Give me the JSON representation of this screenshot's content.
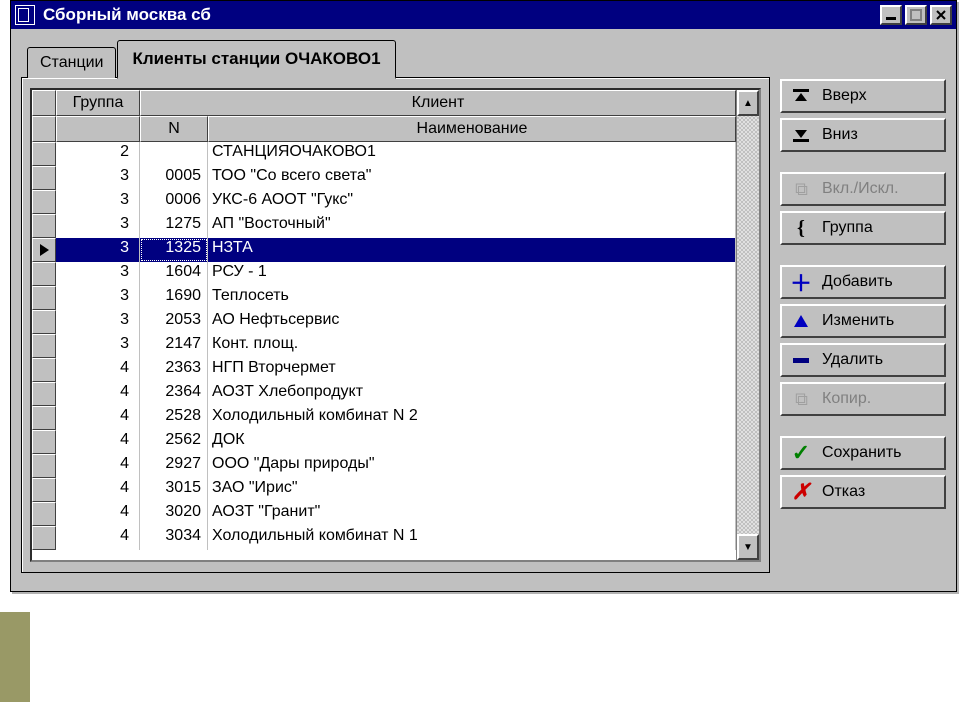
{
  "window": {
    "title": "Сборный москва сб"
  },
  "tabs": {
    "inactive": "Станции",
    "active": "Клиенты станции ОЧАКОВО1"
  },
  "columns": {
    "group": "Группа",
    "client": "Клиент",
    "n": "N",
    "name": "Наименование"
  },
  "rows": [
    {
      "group": "2",
      "n": "",
      "name": "СТАНЦИЯОЧАКОВО1"
    },
    {
      "group": "3",
      "n": "0005",
      "name": "ТОО \"Со всего света\""
    },
    {
      "group": "3",
      "n": "0006",
      "name": "УКС-6 АООТ \"Гукс\""
    },
    {
      "group": "3",
      "n": "1275",
      "name": "АП \"Восточный\""
    },
    {
      "group": "3",
      "n": "1325",
      "name": "НЗТА",
      "selected": true
    },
    {
      "group": "3",
      "n": "1604",
      "name": "РСУ - 1"
    },
    {
      "group": "3",
      "n": "1690",
      "name": "Теплосеть"
    },
    {
      "group": "3",
      "n": "2053",
      "name": "АО Нефтьсервис"
    },
    {
      "group": "3",
      "n": "2147",
      "name": "Конт. площ."
    },
    {
      "group": "4",
      "n": "2363",
      "name": "НГП Вторчермет"
    },
    {
      "group": "4",
      "n": "2364",
      "name": "АОЗТ Хлебопродукт"
    },
    {
      "group": "4",
      "n": "2528",
      "name": "Холодильный комбинат N 2"
    },
    {
      "group": "4",
      "n": "2562",
      "name": "ДОК"
    },
    {
      "group": "4",
      "n": "2927",
      "name": "ООО \"Дары природы\""
    },
    {
      "group": "4",
      "n": "3015",
      "name": "ЗАО \"Ирис\""
    },
    {
      "group": "4",
      "n": "3020",
      "name": "АОЗТ \"Гранит\""
    },
    {
      "group": "4",
      "n": "3034",
      "name": "Холодильный комбинат N 1"
    }
  ],
  "buttons": {
    "up": "Вверх",
    "down": "Вниз",
    "excl": "Вкл./Искл.",
    "group": "Группа",
    "add": "Добавить",
    "edit": "Изменить",
    "del": "Удалить",
    "copy": "Копир.",
    "save": "Сохранить",
    "cancel": "Отказ"
  }
}
